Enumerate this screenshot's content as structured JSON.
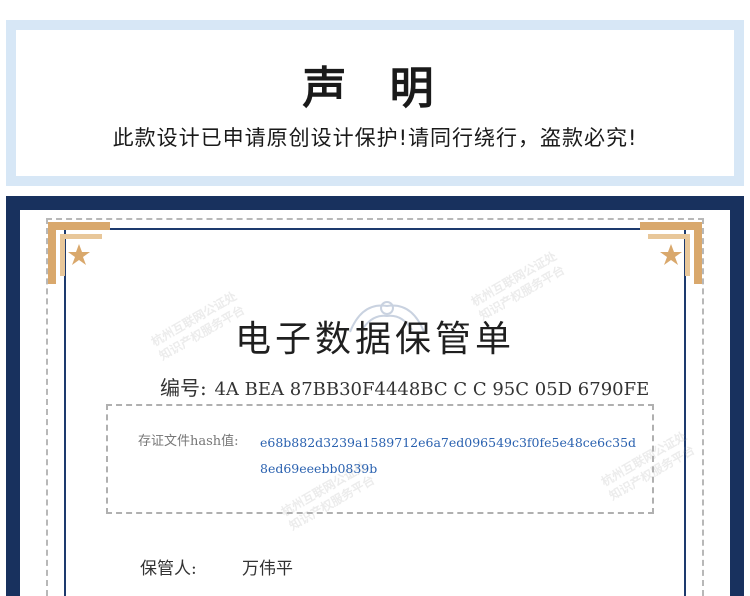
{
  "declaration": {
    "title": "声 明",
    "text": "此款设计已申请原创设计保护!请同行绕行，盗款必究!"
  },
  "certificate": {
    "title": "电子数据保管单",
    "number_label": "编号:",
    "number_value": "4A BEA 87BB30F4448BC C C 95C 05D 6790FE",
    "hash_label": "存证文件hash值:",
    "hash_value": "e68b882d3239a1589712e6a7ed096549c3f0fe5e48ce6c35d8ed69eeebb0839b",
    "keeper_label": "保管人:",
    "keeper_name": "万伟平",
    "watermark_line1": "杭州互联网公证处",
    "watermark_line2": "知识产权服务平台"
  },
  "colors": {
    "frame_navy": "#18315e",
    "panel_blue": "#d7e7f6",
    "corner_gold": "#d9a86c",
    "hash_blue": "#2b62b0"
  }
}
